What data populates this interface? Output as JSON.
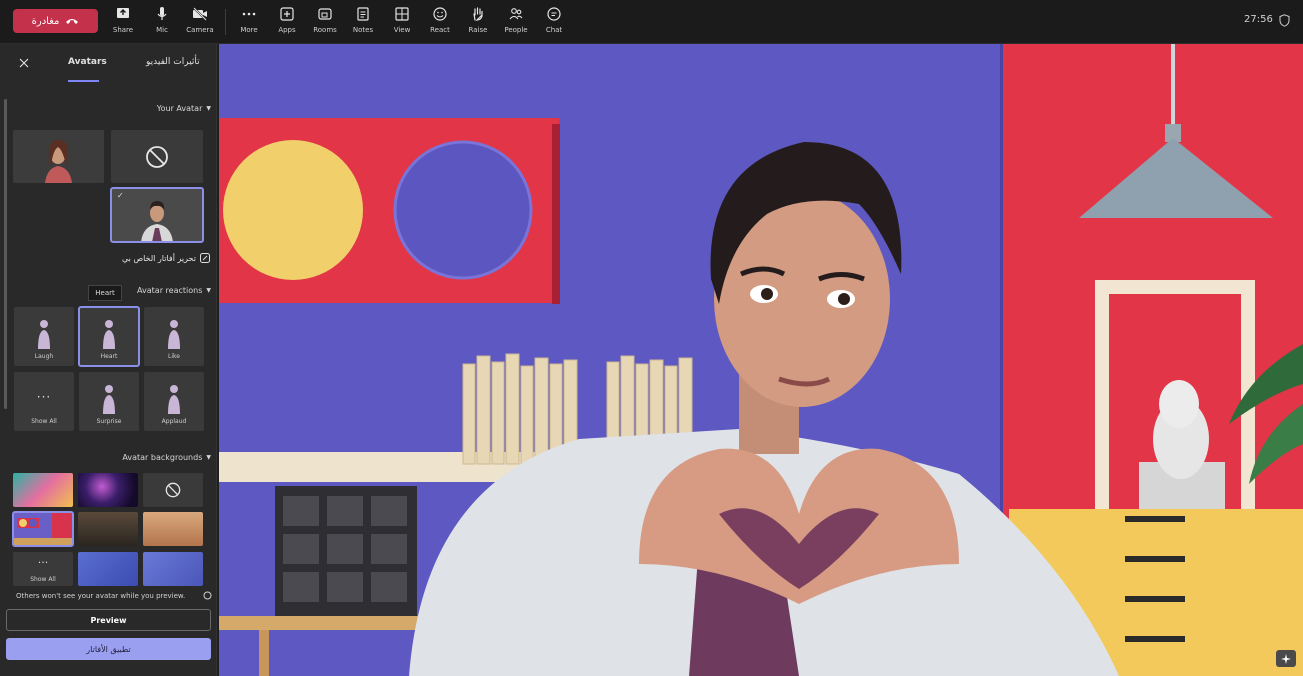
{
  "toolbar": {
    "leave_label": "مغادرة",
    "items": [
      {
        "label": "Share",
        "icon": "share-icon"
      },
      {
        "label": "Mic",
        "icon": "mic-icon"
      },
      {
        "label": "Camera",
        "icon": "camera-off-icon"
      },
      {
        "label": "More",
        "icon": "more-icon"
      },
      {
        "label": "Apps",
        "icon": "apps-icon"
      },
      {
        "label": "Rooms",
        "icon": "rooms-icon"
      },
      {
        "label": "Notes",
        "icon": "notes-icon"
      },
      {
        "label": "View",
        "icon": "view-icon"
      },
      {
        "label": "React",
        "icon": "react-icon"
      },
      {
        "label": "Raise",
        "icon": "raise-hand-icon"
      },
      {
        "label": "People",
        "icon": "people-icon"
      },
      {
        "label": "Chat",
        "icon": "chat-icon"
      }
    ],
    "timer": "27:56"
  },
  "panel": {
    "tabs": [
      {
        "label": "Avatars",
        "active": true
      },
      {
        "label": "تأثيرات الفيديو",
        "active": false
      }
    ],
    "your_avatar": {
      "heading": "Your Avatar",
      "edit_label": "تحرير أفاتار الخاص بي"
    },
    "reactions": {
      "heading": "Avatar reactions",
      "tooltip": "Heart",
      "items": [
        {
          "label": "Like"
        },
        {
          "label": "Heart",
          "selected": true
        },
        {
          "label": "Laugh"
        },
        {
          "label": "Applaud"
        },
        {
          "label": "Surprise"
        },
        {
          "label": "Show All"
        }
      ]
    },
    "backgrounds": {
      "heading": "Avatar backgrounds",
      "show_all": "Show All"
    },
    "notice": "Others won't see your avatar while you preview.",
    "preview_label": "Preview",
    "apply_label": "تطبيق الأفاتار"
  },
  "colors": {
    "accent": "#7f85f5",
    "leave": "#c4314b",
    "apply": "#9a9ff0"
  }
}
